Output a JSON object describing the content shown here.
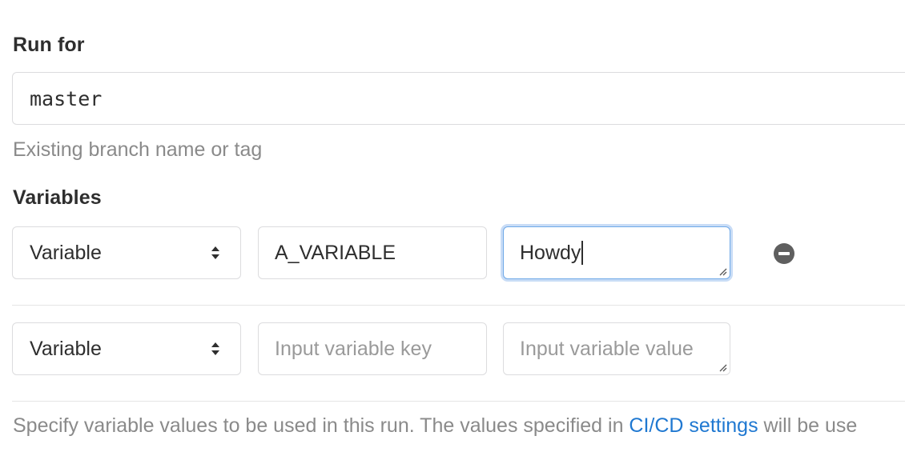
{
  "run_for": {
    "label": "Run for",
    "value": "master",
    "help": "Existing branch name or tag"
  },
  "variables": {
    "label": "Variables",
    "rows": [
      {
        "type": "Variable",
        "key": "A_VARIABLE",
        "value": "Howdy"
      },
      {
        "type": "Variable",
        "key_placeholder": "Input variable key",
        "value_placeholder": "Input variable value"
      }
    ],
    "help_prefix": "Specify variable values to be used in this run. The values specified in ",
    "help_link": "CI/CD settings",
    "help_suffix": " will be use"
  },
  "colors": {
    "focus_ring": "#6fa9e8",
    "link": "#1f78d1"
  },
  "icons": {
    "select_arrows": "sort-arrows-icon",
    "remove": "remove-circle-icon",
    "resize": "resize-handle-icon"
  }
}
